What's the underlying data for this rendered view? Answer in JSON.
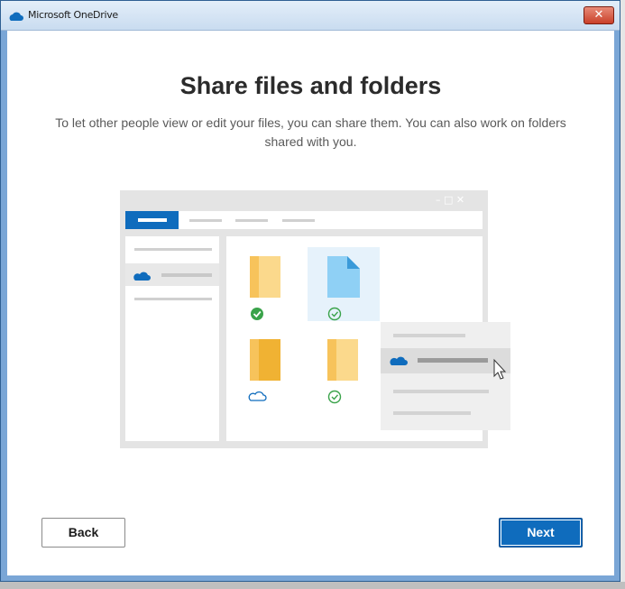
{
  "window": {
    "title": "Microsoft OneDrive",
    "close_symbol": "✕"
  },
  "page": {
    "heading": "Share files and folders",
    "subtitle": "To let other people view or edit your files, you can share them. You can also work on folders shared with you."
  },
  "illustration": {
    "title_controls": "– □ ✕",
    "icons": [
      "onedrive-cloud-icon",
      "folder-icon",
      "file-icon",
      "check-circle-icon",
      "cloud-outline-icon",
      "cursor-icon"
    ]
  },
  "buttons": {
    "back": "Back",
    "next": "Next"
  },
  "colors": {
    "accent": "#0f6cbd",
    "sync_green": "#3aa34a",
    "cloud_blue": "#0f6cbd",
    "folder_yellow": "#f6c04f"
  }
}
